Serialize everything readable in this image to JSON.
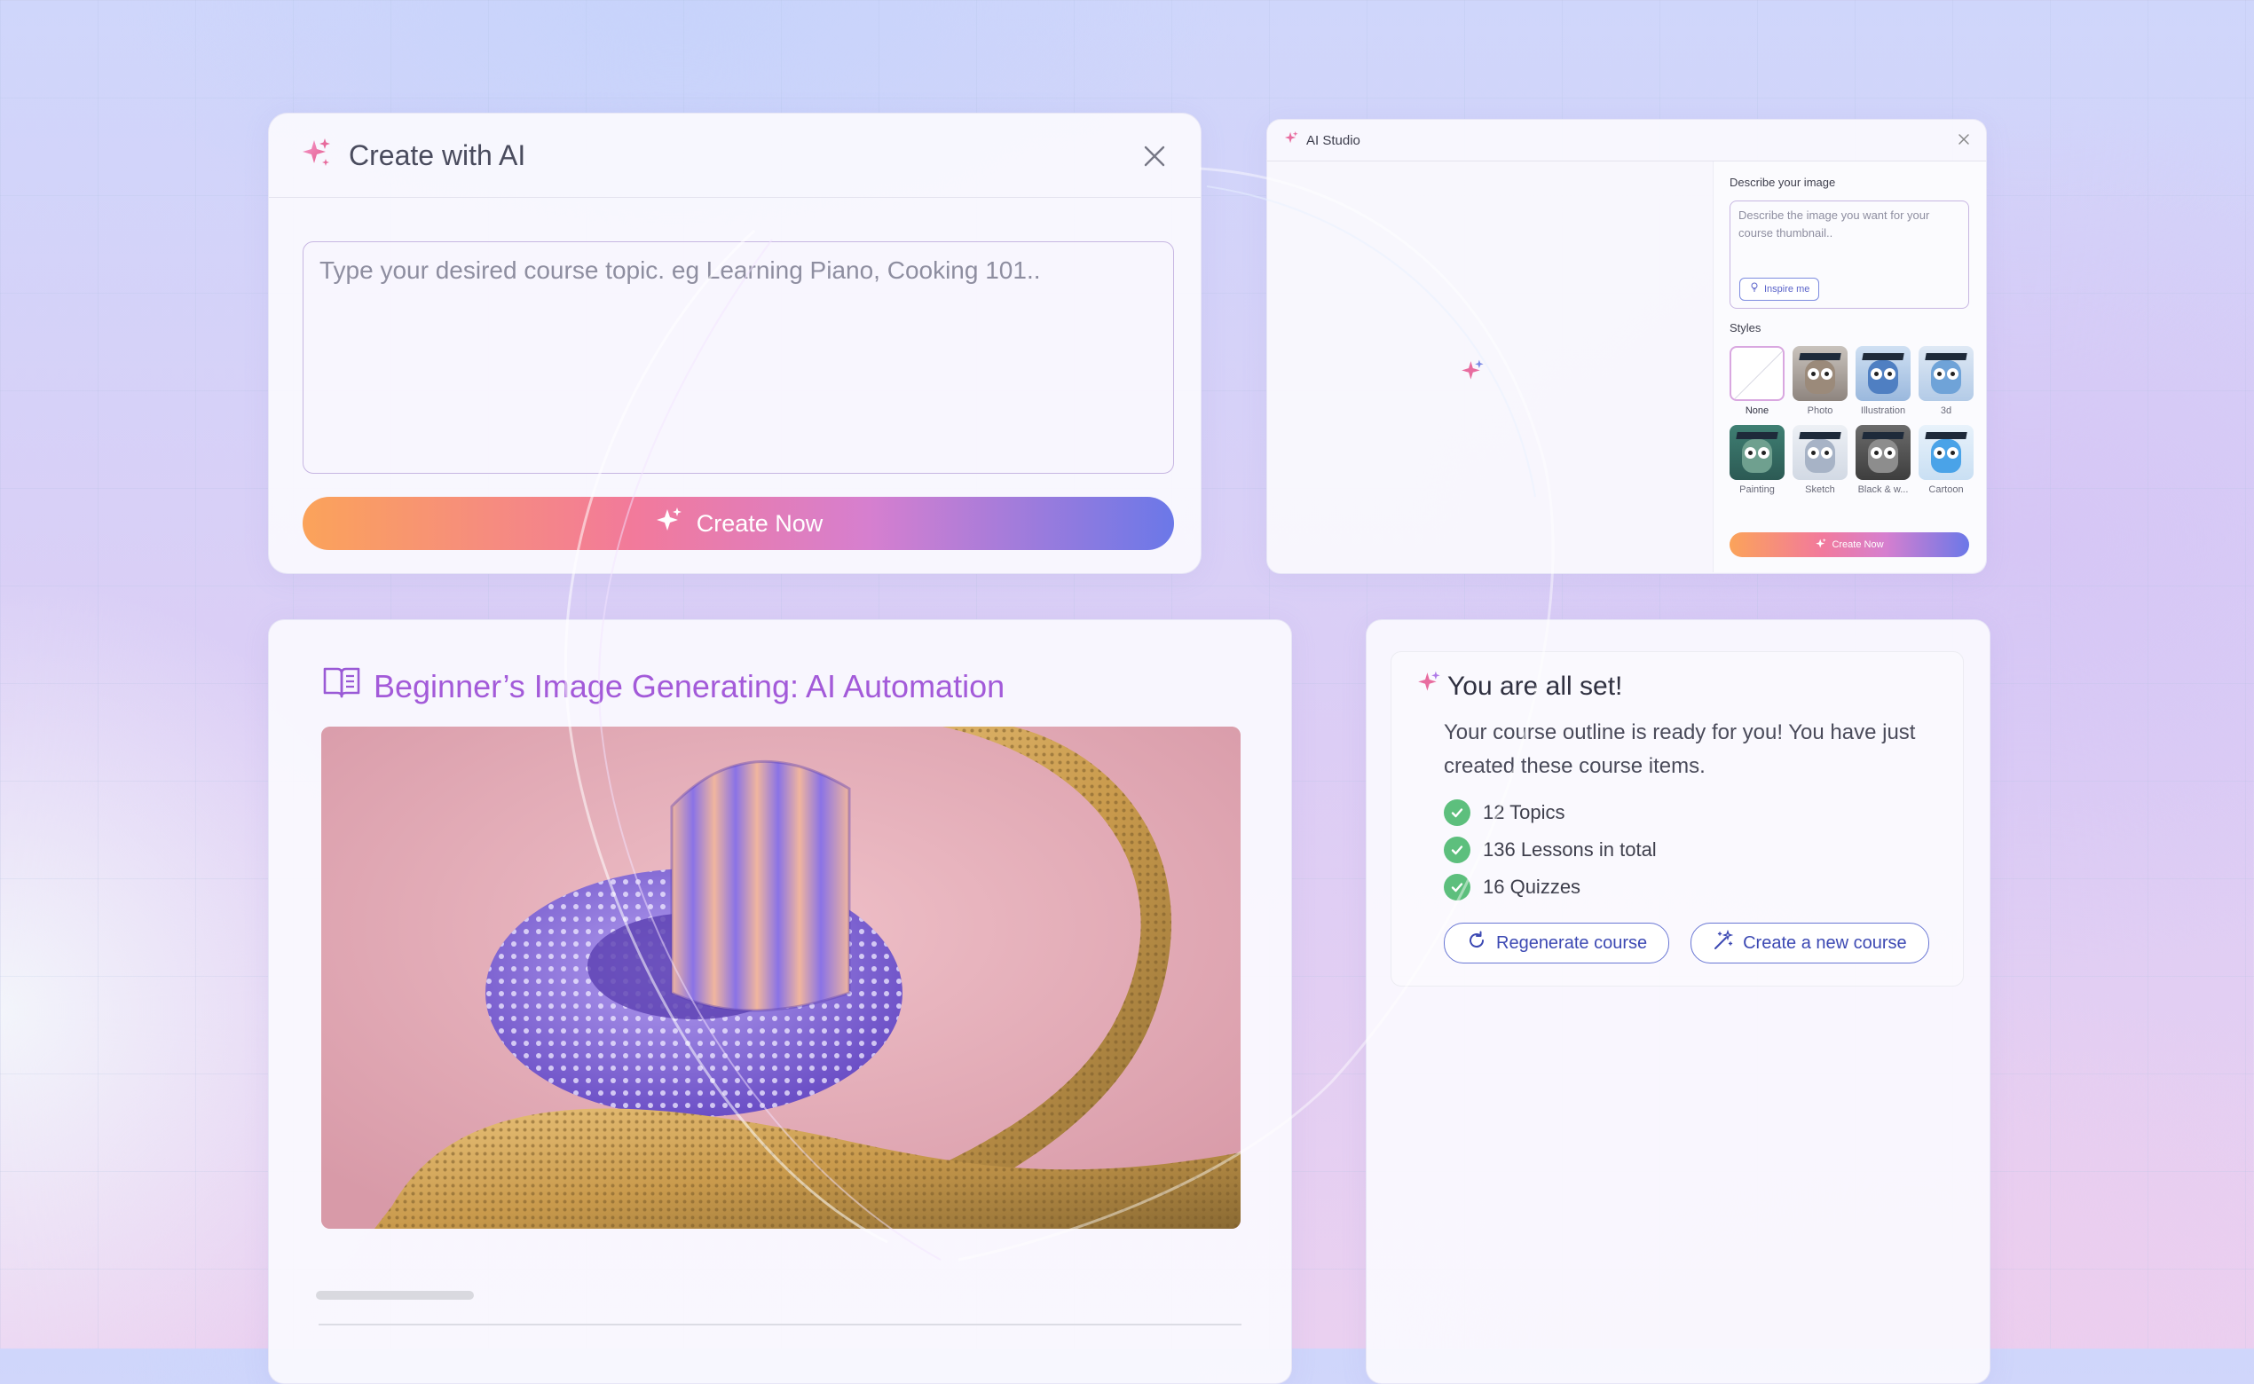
{
  "colors": {
    "accent_purple": "#a35ad9",
    "button_gradient": [
      "#fba35a",
      "#f27a9b",
      "#d67fcf",
      "#6b78e8"
    ],
    "check_green": "#5dbf7d",
    "outline_blue": "#6876d4"
  },
  "create_dialog": {
    "title": "Create with AI",
    "icon": "sparkle-icon",
    "close_icon": "close-icon",
    "input_placeholder": "Type your desired course topic. eg Learning Piano, Cooking 101..",
    "input_value": "",
    "submit_label": "Create Now"
  },
  "ai_studio": {
    "title": "AI Studio",
    "describe_label": "Describe your image",
    "describe_placeholder": "Describe the image you want for your course thumbnail..",
    "inspire_label": "Inspire me",
    "styles_label": "Styles",
    "styles": [
      {
        "name": "None",
        "selected": true
      },
      {
        "name": "Photo",
        "selected": false
      },
      {
        "name": "Illustration",
        "selected": false
      },
      {
        "name": "3d",
        "selected": false
      },
      {
        "name": "Painting",
        "selected": false
      },
      {
        "name": "Sketch",
        "selected": false
      },
      {
        "name": "Black & w...",
        "selected": false
      },
      {
        "name": "Cartoon",
        "selected": false
      }
    ],
    "submit_label": "Create Now"
  },
  "course": {
    "title": "Beginner’s Image Generating: AI Automation",
    "icon": "book-icon"
  },
  "summary": {
    "title": "You are all set!",
    "message": "Your course outline is ready for you! You have just created these course items.",
    "items": [
      "12 Topics",
      "136 Lessons in total",
      "16 Quizzes"
    ],
    "regenerate_label": "Regenerate course",
    "new_course_label": "Create a new course"
  }
}
